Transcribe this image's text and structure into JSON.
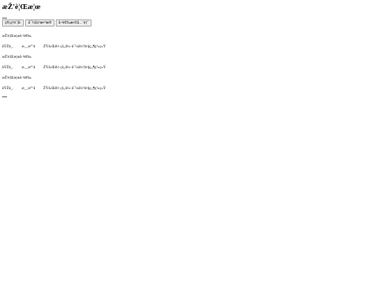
{
  "page": {
    "title": "æŽ'è¦Œæ¦œ"
  },
  "toolbar": {
    "buttons": [
      {
        "label": "ç®¡ç†è´¦å·"
      },
      {
        "label": "å¯¼å‡ºæ•°æ®"
      },
      {
        "label": "å·²é€‰æ‹©å…¨éƒ¨"
      }
    ]
  },
  "records": [
    {
      "title": "æŽ'è¦Œæ¦œå·²é€‰",
      "col1": "åŸŽå¸‚",
      "col2": "æ__æ°‘å",
      "col3": "ŽŸå›Œå½ çš„å¼–å¯¼å¼ºå¤§ç„¶ç³»ç»Ÿ"
    },
    {
      "title": "æŽ'è¦Œæ¦œå·²é€‰",
      "col1": "åŸŽå¸‚",
      "col2": "æ__æ°‘å",
      "col3": "ŽŸå›Œå½ çš„å¼–å¯¼å¼ºå¤§ç„¶ç³»ç»Ÿ"
    },
    {
      "title": "æŽ'è¦Œæ¦œå·²é€‰",
      "col1": "åŸŽå¸‚",
      "col2": "æ__æ°‘å",
      "col3": "ŽŸå›Œå½ çš„å¼–å¯¼å¼ºå¤§ç„¶ç³»ç»Ÿ"
    }
  ]
}
